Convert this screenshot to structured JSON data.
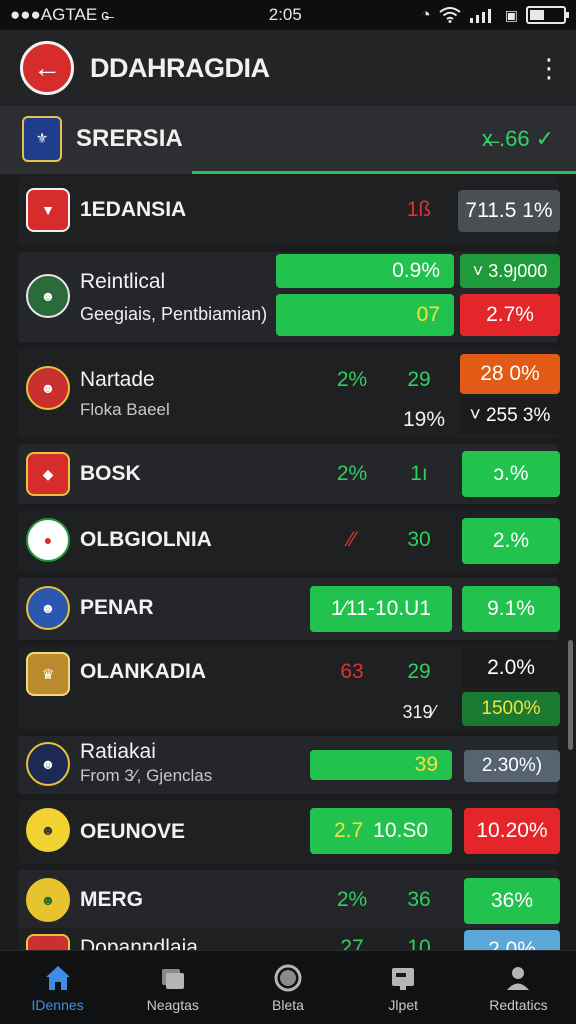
{
  "status": {
    "carrier": "●●●AGTAE",
    "time": "2:05"
  },
  "header": {
    "title": "DDAHRAGDIA",
    "back_glyph": "←",
    "more_glyph": "⋮"
  },
  "section": {
    "title": "SRERSIA",
    "odds": "x̶ .66",
    "odds_glyph": "✓"
  },
  "rows": [
    {
      "name": "1EDANSIA",
      "v1": "1ß",
      "p1": "711.5 1%"
    },
    {
      "name": "Reintlical",
      "sub": "Geegiais, Pentbiamian)",
      "p_top": "0.9%",
      "p_top_r": "˅ 3.9ȷ000",
      "p_bot": "07",
      "p_bot_r": "2.7%"
    },
    {
      "name": "Nartade",
      "sub": "Floka Baeel",
      "v1": "2%",
      "v2": "29",
      "v3": "19%",
      "p1": "28 0%",
      "p2": "˅ 255 3%"
    },
    {
      "name": "BOSK",
      "v1": "2%",
      "v2": "1ı",
      "p1": "ɔ.%"
    },
    {
      "name": "OLBGIOLNIA",
      "v1": "⁄⁄",
      "v2": "30",
      "p1": "2.%"
    },
    {
      "name": "PENAR",
      "p_mid": "1⁄11-10.U1",
      "p1": "9.1%"
    },
    {
      "name": "OLANKADIA",
      "v1": "63",
      "v2": "29",
      "v3": "319⁄",
      "p1": "2.0%",
      "p2": "1500%"
    },
    {
      "name": "Ratiakai",
      "sub": "From 3⁄, Gjenclas",
      "p_mid": "39",
      "p1": "2.30%)"
    },
    {
      "name": "OEUNOVE",
      "p_mid_a": "2.7",
      "p_mid_b": "10.S0",
      "p1": "10.20%"
    },
    {
      "name": "MERG",
      "v1": "2%",
      "v2": "36",
      "p1": "36%"
    },
    {
      "name": "Dopanndlaja",
      "v1": "27",
      "v2": "10",
      "p1": "2.0%"
    }
  ],
  "nav": [
    {
      "label": "IDennes",
      "icon": "home-icon"
    },
    {
      "label": "Neagtas",
      "icon": "stack-icon"
    },
    {
      "label": "Bleta",
      "icon": "circle-icon"
    },
    {
      "label": "Jlpet",
      "icon": "card-icon"
    },
    {
      "label": "Redtatics",
      "icon": "profile-icon"
    }
  ],
  "colors": {
    "accent_green": "#22c24e",
    "accent_red": "#e4262b",
    "nav_active": "#3d8de6",
    "back_button": "#d62c2c"
  }
}
